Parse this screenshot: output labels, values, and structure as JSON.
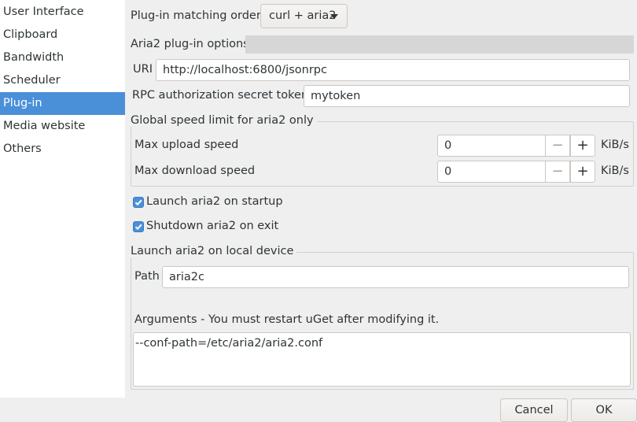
{
  "sidebar": {
    "items": [
      {
        "label": "User Interface"
      },
      {
        "label": "Clipboard"
      },
      {
        "label": "Bandwidth"
      },
      {
        "label": "Scheduler"
      },
      {
        "label": "Plug-in"
      },
      {
        "label": "Media website"
      },
      {
        "label": "Others"
      }
    ],
    "selected": "Plug-in"
  },
  "plugin": {
    "order_label": "Plug-in matching order:",
    "order_value": "curl + aria2",
    "aria2_options_label": "Aria2 plug-in options",
    "uri_label": "URI",
    "uri_value": "http://localhost:6800/jsonrpc",
    "token_label": "RPC authorization secret token",
    "token_value": "mytoken"
  },
  "speed": {
    "frame_label": "Global speed limit for aria2 only",
    "upload_label": "Max upload speed",
    "upload_value": "0",
    "download_label": "Max download speed",
    "download_value": "0",
    "unit": "KiB/s",
    "minus": "−",
    "plus": "+"
  },
  "options": {
    "launch_startup": "Launch aria2 on startup",
    "launch_startup_checked": true,
    "shutdown_exit": "Shutdown aria2 on exit",
    "shutdown_exit_checked": true
  },
  "local": {
    "frame_label": "Launch aria2 on local device",
    "path_label": "Path",
    "path_value": "aria2c",
    "args_label": "Arguments  - You must restart uGet after modifying it.",
    "args_value": "--conf-path=/etc/aria2/aria2.conf"
  },
  "dialog": {
    "cancel": "Cancel",
    "ok": "OK"
  },
  "colors": {
    "accent": "#4a90d9",
    "background": "#efefef"
  },
  "icons": {
    "dropdown": "triangle-down-icon",
    "checkbox": "checkmark-icon"
  }
}
